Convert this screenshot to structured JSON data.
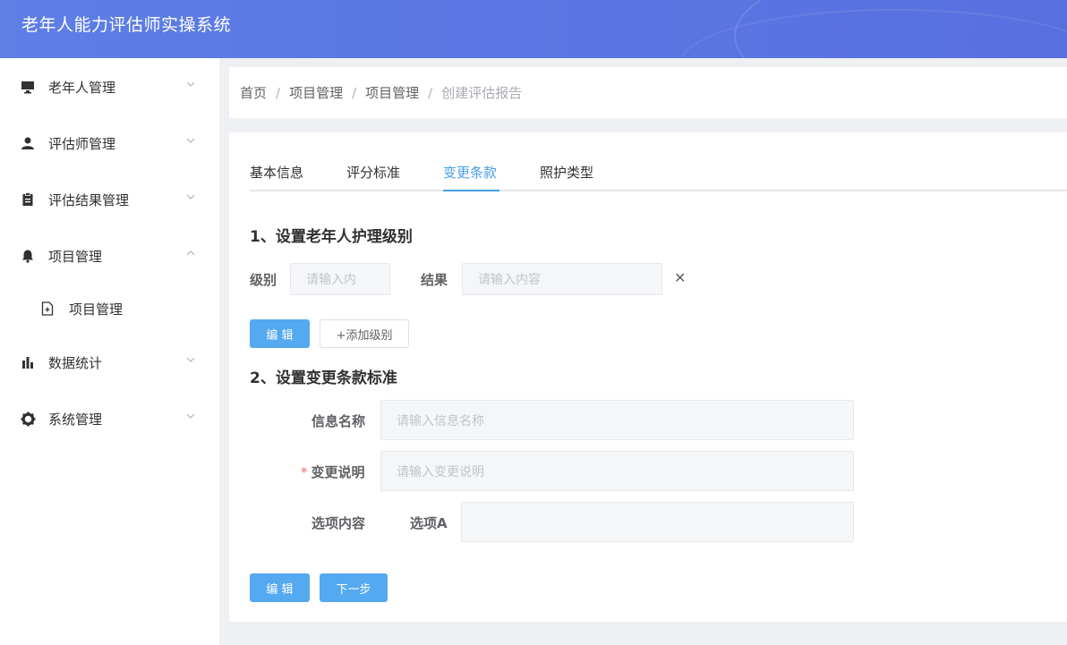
{
  "app": {
    "title": "老年人能力评估师实操系统"
  },
  "sidebar": {
    "items": [
      {
        "label": "老年人管理",
        "icon": "monitor-icon",
        "expanded": false
      },
      {
        "label": "评估师管理",
        "icon": "user-icon",
        "expanded": false
      },
      {
        "label": "评估结果管理",
        "icon": "clipboard-icon",
        "expanded": false
      },
      {
        "label": "项目管理",
        "icon": "bell-icon",
        "expanded": true
      },
      {
        "label": "项目管理",
        "icon": "document-add-icon",
        "sub": true
      },
      {
        "label": "数据统计",
        "icon": "bar-chart-icon",
        "expanded": false
      },
      {
        "label": "系统管理",
        "icon": "gear-icon",
        "expanded": false
      }
    ]
  },
  "breadcrumb": [
    "首页",
    "项目管理",
    "项目管理",
    "创建评估报告"
  ],
  "tabs": [
    "基本信息",
    "评分标准",
    "变更条款",
    "照护类型"
  ],
  "active_tab": "变更条款",
  "section1": {
    "title": "1、设置老年人护理级别",
    "level_label": "级别",
    "level_placeholder": "请输入内",
    "result_label": "结果",
    "result_placeholder": "请输入内容",
    "edit_button": "编 辑",
    "add_level_button": "+添加级别"
  },
  "section2": {
    "title": "2、设置变更条款标准",
    "info_name_label": "信息名称",
    "info_name_placeholder": "请输入信息名称",
    "required_mark": "*",
    "change_desc_label": "变更说明",
    "change_desc_placeholder": "请输入变更说明",
    "option_content_label": "选项内容",
    "option_a_label": "选项A",
    "option_a_value": "",
    "edit_button": "编 辑",
    "next_button": "下一步"
  },
  "colors": {
    "header": "#5a77e4",
    "accent": "#4a9de8",
    "primary_button": "#55a9f0",
    "required": "#f56c6c"
  }
}
